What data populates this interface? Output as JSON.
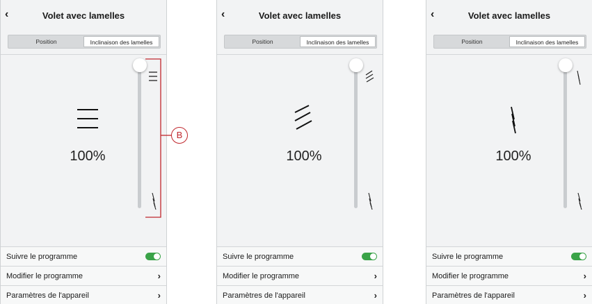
{
  "screens": [
    {
      "title": "Volet avec lamelles",
      "tabs": [
        "Position",
        "Inclinaison des lamelles"
      ],
      "selected_tab": "Inclinaison des lamelles",
      "tilt_state": "horizontal",
      "percent": "100%",
      "slider_value_percent": 100,
      "rows": {
        "follow_schedule": "Suivre le programme",
        "follow_schedule_on": true,
        "edit_schedule": "Modifier le programme",
        "device_settings": "Paramètres de l'appareil"
      }
    },
    {
      "title": "Volet avec lamelles",
      "tabs": [
        "Position",
        "Inclinaison des lamelles"
      ],
      "selected_tab": "Inclinaison des lamelles",
      "tilt_state": "diagonal",
      "percent": "100%",
      "slider_value_percent": 100,
      "rows": {
        "follow_schedule": "Suivre le programme",
        "follow_schedule_on": true,
        "edit_schedule": "Modifier le programme",
        "device_settings": "Paramètres de l'appareil"
      }
    },
    {
      "title": "Volet avec lamelles",
      "tabs": [
        "Position",
        "Inclinaison des lamelles"
      ],
      "selected_tab": "Inclinaison des lamelles",
      "tilt_state": "vertical",
      "percent": "100%",
      "slider_value_percent": 100,
      "rows": {
        "follow_schedule": "Suivre le programme",
        "follow_schedule_on": true,
        "edit_schedule": "Modifier le programme",
        "device_settings": "Paramètres de l'appareil"
      }
    }
  ],
  "callout": {
    "label": "B",
    "color": "#c0272d"
  },
  "colors": {
    "toggle_on": "#3aa348",
    "background": "#f2f3f4"
  },
  "icons": {
    "back": "chevron-left-icon",
    "chevron": "chevron-right-icon"
  }
}
